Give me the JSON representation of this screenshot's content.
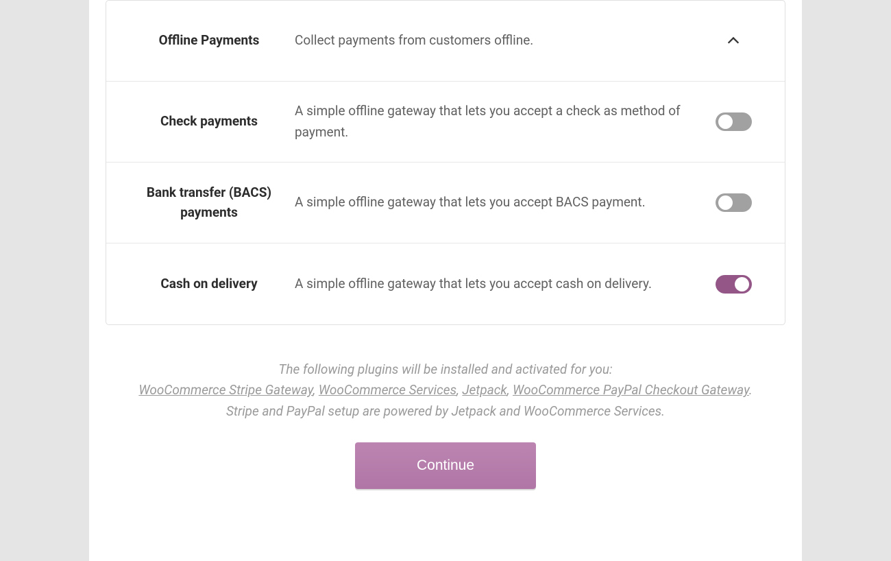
{
  "panel": {
    "header": {
      "title": "Offline Payments",
      "description": "Collect payments from customers offline."
    },
    "rows": [
      {
        "title": "Check payments",
        "description": "A simple offline gateway that lets you accept a check as method of payment.",
        "enabled": false
      },
      {
        "title": "Bank transfer (BACS) payments",
        "description": "A simple offline gateway that lets you accept BACS payment.",
        "enabled": false
      },
      {
        "title": "Cash on delivery",
        "description": "A simple offline gateway that lets you accept cash on delivery.",
        "enabled": true
      }
    ]
  },
  "footer": {
    "intro": "The following plugins will be installed and activated for you:",
    "links": {
      "stripe": "WooCommerce Stripe Gateway",
      "services": "WooCommerce Services",
      "jetpack": "Jetpack",
      "paypal": "WooCommerce PayPal Checkout Gateway"
    },
    "outro": ". Stripe and PayPal setup are powered by Jetpack and WooCommerce Services."
  },
  "continue_label": "Continue"
}
